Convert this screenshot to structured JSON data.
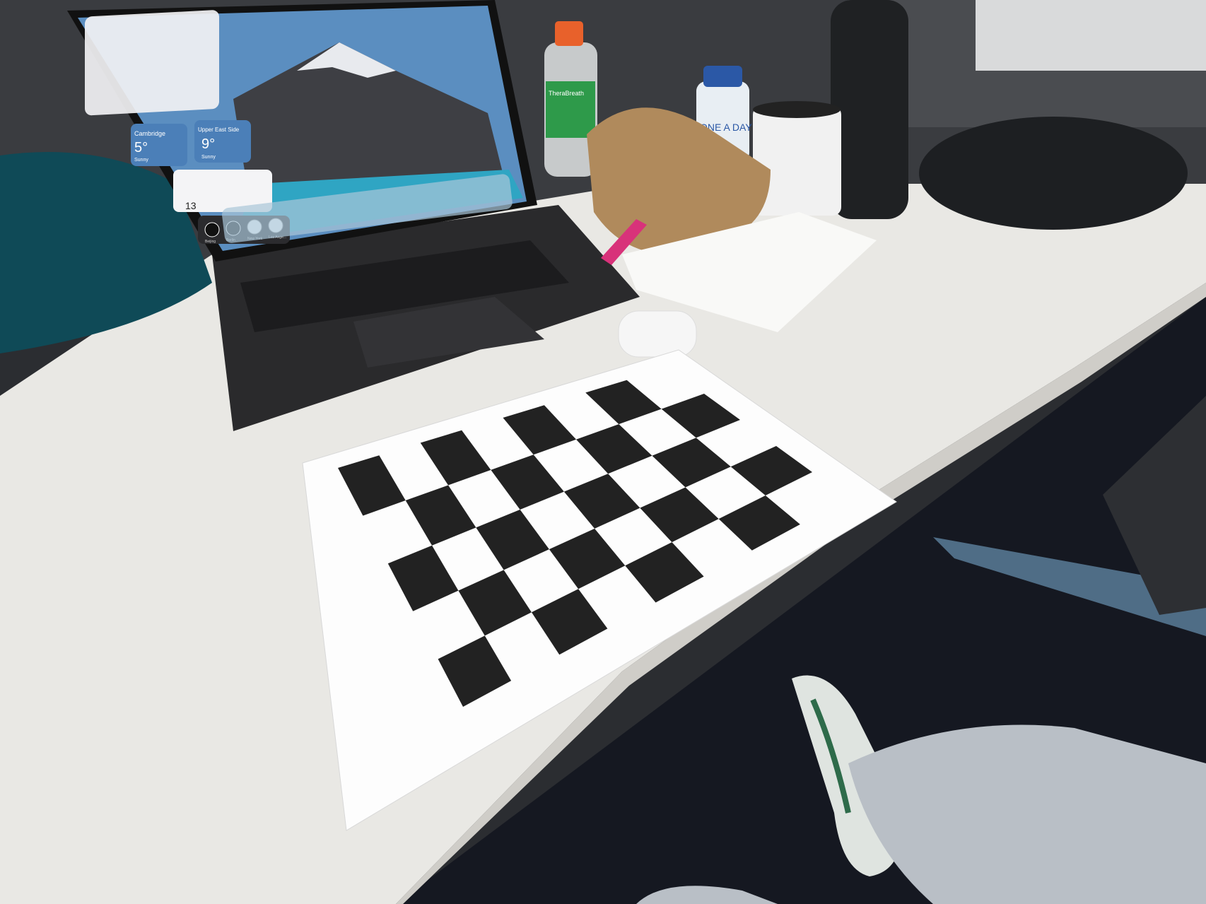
{
  "scene": {
    "description_hidden": "",
    "widgets": {
      "weather_left_city": "Cambridge",
      "weather_left_temp": "5°",
      "weather_right_city": "Upper East Side",
      "weather_right_temp": "9°",
      "weather_left_cond": "Sunny",
      "weather_right_cond": "Sunny",
      "reminders_count": "13",
      "clock_cities": [
        "Beijing",
        "Berlin",
        "New York",
        "Los Ange..."
      ]
    },
    "products": {
      "mouthwash_brand": "TheraBreath",
      "vitamins_brand": "ONE A DAY"
    },
    "colors": {
      "desk": "#e9e8e4",
      "floor": "#151821",
      "checker_dark": "#222222",
      "checker_light": "#fbfbfb",
      "laptop": "#2a2a2c",
      "ruler": "#d8327a",
      "jeans": "#b9bfc6"
    }
  }
}
